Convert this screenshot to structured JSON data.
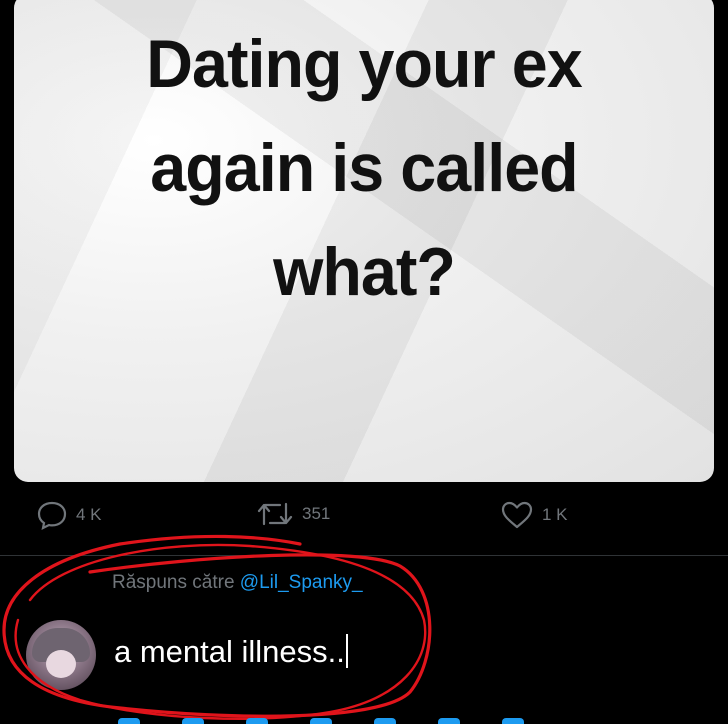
{
  "post": {
    "image_text_lines": [
      "Dating your ex",
      "again is called",
      "what?"
    ]
  },
  "actions": {
    "replies": "4 K",
    "reposts": "351",
    "likes": "1 K"
  },
  "reply": {
    "prefix": "Răspuns către ",
    "handle": "@Lil_Spanky_",
    "input_value": "a mental illness.."
  },
  "colors": {
    "background": "#000000",
    "muted": "#71767b",
    "accent": "#1d9bf0",
    "annotation": "#e0141b"
  },
  "icons": [
    "reply-icon",
    "repost-icon",
    "like-icon"
  ]
}
